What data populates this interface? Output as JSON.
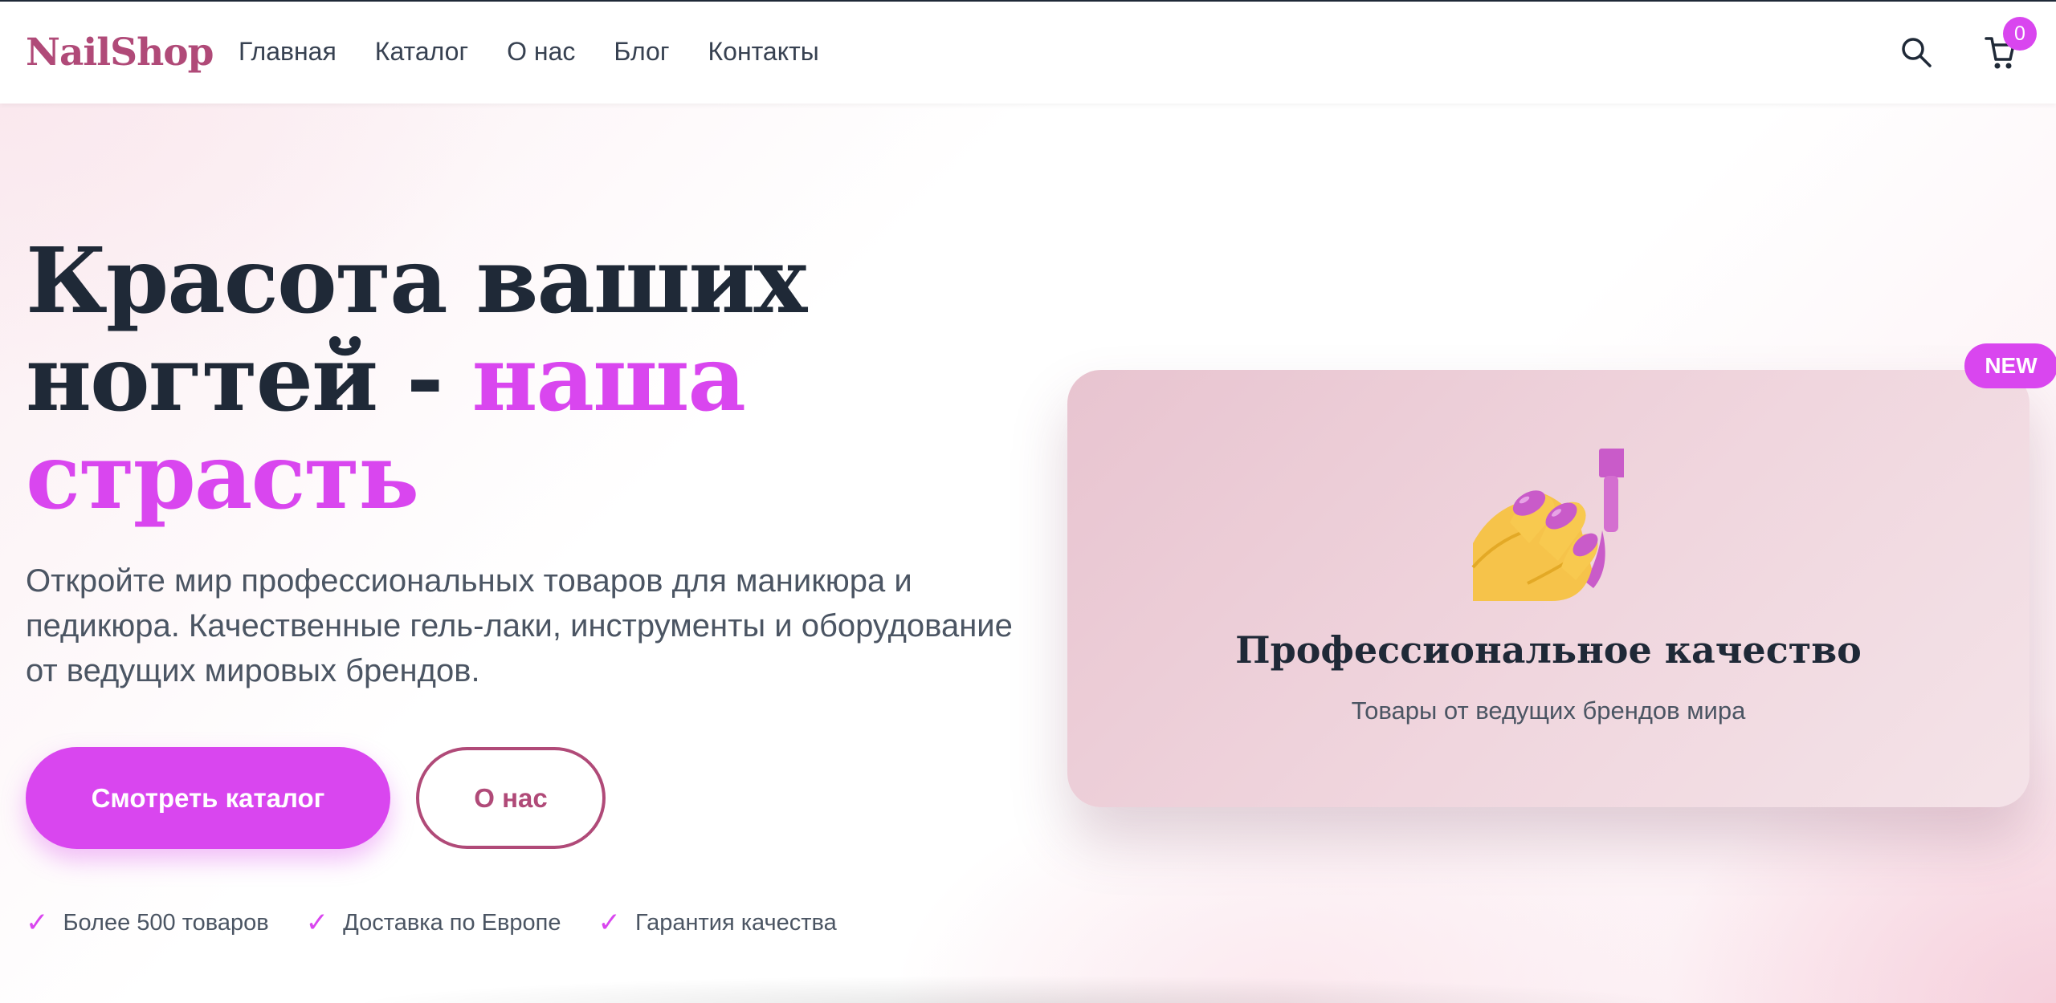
{
  "header": {
    "logo": "NailShop",
    "nav": [
      "Главная",
      "Каталог",
      "О нас",
      "Блог",
      "Контакты"
    ],
    "search_icon": "search-icon",
    "cart_icon": "cart-icon",
    "cart_count": "0"
  },
  "hero": {
    "headline_part1": "Красота ваших ногтей - ",
    "headline_accent": "наша страсть",
    "subtext": "Откройте мир профессиональных товаров для маникюра и педикюра. Качественные гель-лаки, инструменты и оборудование от ведущих мировых брендов.",
    "primary_button": "Смотреть каталог",
    "secondary_button": "О нас",
    "features": [
      "Более 500 товаров",
      "Доставка по Европе",
      "Гарантия качества"
    ],
    "check_icon": "check-icon"
  },
  "card": {
    "badge": "NEW",
    "icon": "nail-polish-icon",
    "title": "Профессиональное качество",
    "subtitle": "Товары от ведущих брендов мира"
  },
  "colors": {
    "accent": "#d946ef",
    "brand": "#b04a78",
    "text_dark": "#1f2937",
    "text_muted": "#4b5563"
  }
}
